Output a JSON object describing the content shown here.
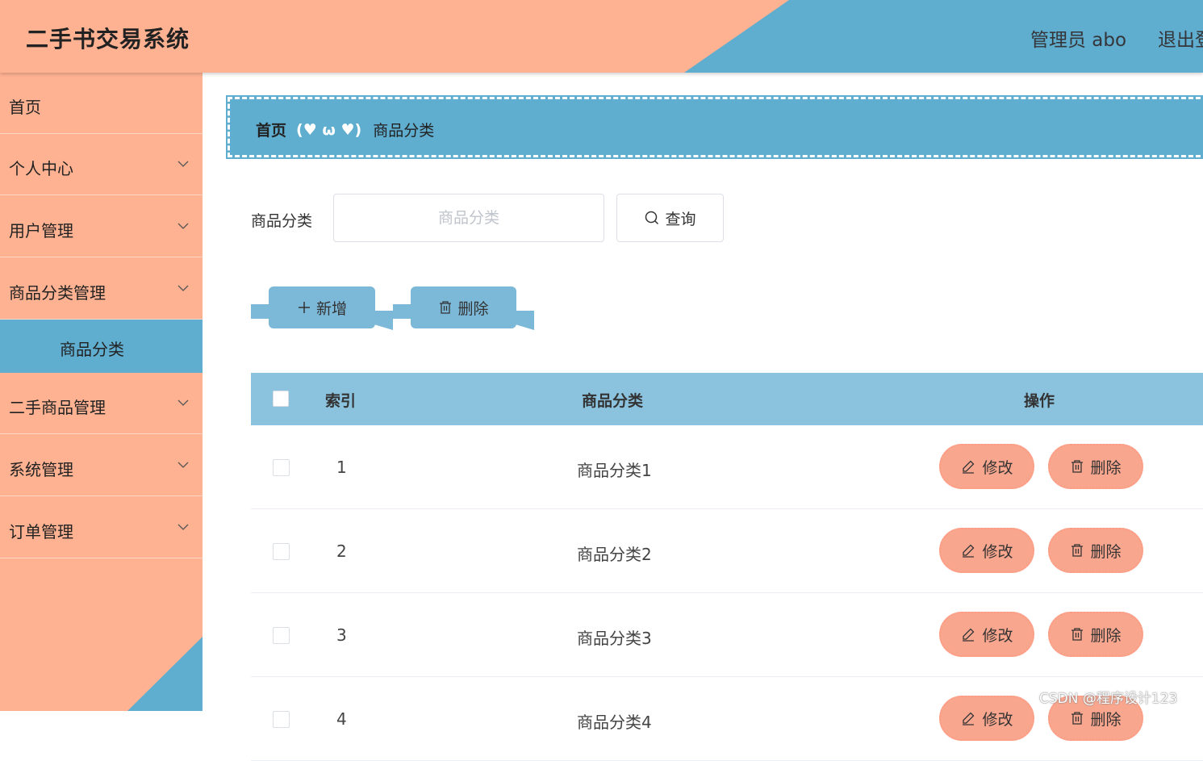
{
  "header": {
    "title": "二手书交易系统",
    "admin_label": "管理员 abo",
    "logout_label": "退出登录"
  },
  "sidebar": {
    "items": [
      {
        "label": "首页",
        "has_arrow": false
      },
      {
        "label": "个人中心",
        "has_arrow": true
      },
      {
        "label": "用户管理",
        "has_arrow": true
      },
      {
        "label": "商品分类管理",
        "has_arrow": true,
        "expanded": true
      },
      {
        "label": "二手商品管理",
        "has_arrow": true
      },
      {
        "label": "系统管理",
        "has_arrow": true
      },
      {
        "label": "订单管理",
        "has_arrow": true
      }
    ],
    "active_subitem": "商品分类"
  },
  "breadcrumb": {
    "home": "首页",
    "separator": "(♥ ω ♥)",
    "current": "商品分类"
  },
  "search": {
    "label": "商品分类",
    "placeholder": "商品分类",
    "value": "",
    "button_label": "查询"
  },
  "actions": {
    "add_label": "新增",
    "delete_label": "删除"
  },
  "table": {
    "columns": [
      "索引",
      "商品分类",
      "操作"
    ],
    "rows": [
      {
        "index": "1",
        "name": "商品分类1"
      },
      {
        "index": "2",
        "name": "商品分类2"
      },
      {
        "index": "3",
        "name": "商品分类3"
      },
      {
        "index": "4",
        "name": "商品分类4"
      }
    ],
    "edit_label": "修改",
    "delete_label": "删除"
  },
  "watermark": "CSDN @程序设计123",
  "colors": {
    "salmon": "#ffb292",
    "blue": "#5fadcf",
    "table_head": "#8bc3df",
    "pill": "#f9a68e"
  }
}
